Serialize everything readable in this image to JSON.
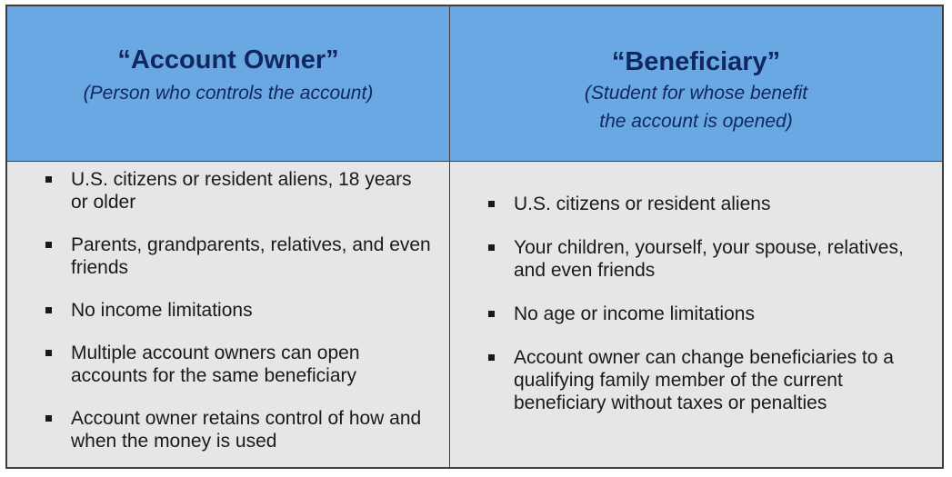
{
  "owner": {
    "title": "“Account Owner”",
    "subtitle": "(Person who controls the account)",
    "items": [
      "U.S. citizens or resident aliens, 18 years or older",
      "Parents, grandparents, relatives, and even friends",
      "No income limitations",
      "Multiple account owners can open accounts for the same beneficiary",
      "Account owner retains control of how and when the money is used"
    ]
  },
  "beneficiary": {
    "title": "“Beneficiary”",
    "subtitle_line1": "(Student for whose benefit",
    "subtitle_line2": "the account is opened)",
    "items": [
      "U.S. citizens or resident aliens",
      "Your children, yourself, your spouse, relatives, and even friends",
      "No age or income limitations",
      "Account owner can change beneficiaries to a qualifying family member of the current beneficiary without taxes or penalties"
    ]
  },
  "colors": {
    "header_bg": "#6aa8e4",
    "header_text": "#10275f",
    "body_bg": "#e6e5e8",
    "border": "#3f3f3f"
  },
  "icons": {
    "bullet": "square-bullet-icon"
  }
}
